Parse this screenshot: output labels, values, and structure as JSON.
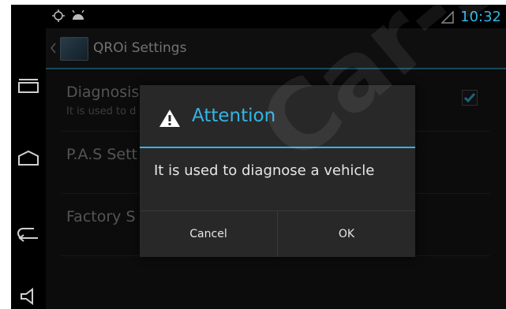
{
  "status_bar": {
    "time": "10:32",
    "icons": [
      "gps-icon",
      "android-icon",
      "signal-icon"
    ]
  },
  "action_bar": {
    "title": "QROi Settings",
    "back_icon": "chevron-left-icon",
    "app_icon": "settings-app-icon"
  },
  "settings_list": [
    {
      "title": "Diagnosis",
      "subtitle": "It is used to d",
      "checked": true
    },
    {
      "title": "P.A.S Sett",
      "subtitle": "",
      "checked": false
    },
    {
      "title": "Factory S",
      "subtitle": "",
      "checked": false
    }
  ],
  "nav_buttons": [
    "recent-apps-icon",
    "home-icon",
    "back-icon",
    "volume-icon"
  ],
  "dialog": {
    "title": "Attention",
    "icon": "warning-icon",
    "message": "It is used to diagnose a vehicle",
    "cancel_label": "Cancel",
    "ok_label": "OK"
  },
  "watermark": "Car-SO",
  "colors": {
    "accent": "#33b5e5",
    "background": "#161616",
    "dialog_bg": "#282828",
    "checkbox_accent": "#33b5e5"
  }
}
